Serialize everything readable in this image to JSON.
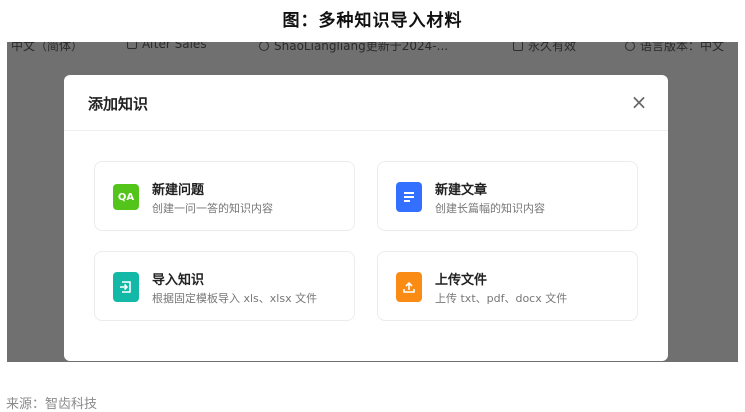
{
  "caption": "图：多种知识导入材料",
  "topbar": {
    "language": "中文（简体）",
    "category": "After Sales",
    "update": "ShaoLiangliang更新于2024-...",
    "validity": "永久有效",
    "version_label": "语言版本：中文"
  },
  "modal": {
    "title": "添加知识",
    "close_glyph": "×",
    "options": [
      {
        "title": "新建问题",
        "desc": "创建一问一答的知识内容",
        "icon": "qa-icon",
        "icon_text": "QA",
        "icon_color": "#52c41a"
      },
      {
        "title": "新建文章",
        "desc": "创建长篇幅的知识内容",
        "icon": "document-icon",
        "icon_color": "#3370ff"
      },
      {
        "title": "导入知识",
        "desc": "根据固定模板导入 xls、xlsx 文件",
        "icon": "import-icon",
        "icon_color": "#14b8a6"
      },
      {
        "title": "上传文件",
        "desc": "上传 txt、pdf、docx 文件",
        "icon": "upload-icon",
        "icon_color": "#fa8c16"
      }
    ]
  },
  "source": "来源：智齿科技"
}
